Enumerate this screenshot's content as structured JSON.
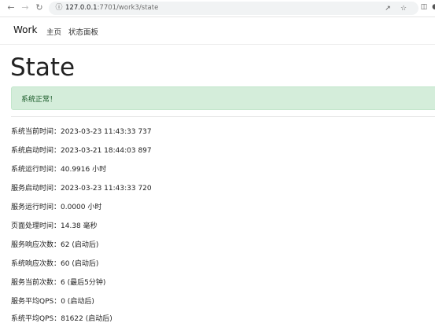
{
  "browser": {
    "url_host": "127.0.0.1",
    "url_path": ":7701/work3/state",
    "icons": {
      "back": "back-arrow-icon",
      "forward": "forward-arrow-icon",
      "reload": "reload-icon",
      "site_info": "site-info-icon",
      "share": "share-icon",
      "bookmark": "star-icon",
      "sidebar": "sidebar-icon",
      "profile": "profile-icon"
    }
  },
  "navbar": {
    "brand": "Work",
    "links": [
      "主页",
      "状态面板"
    ]
  },
  "page": {
    "title": "State",
    "alert": "系统正常！",
    "alert_color": "#d4edda"
  },
  "stats": [
    "系统当前时间：2023-03-23 11:43:33 737",
    "系统启动时间：2023-03-21 18:44:03 897",
    "系统运行时间：40.9916 小时",
    "服务启动时间：2023-03-23 11:43:33 720",
    "服务运行时间：0.0000 小时",
    "页面处理时间：14.38 毫秒",
    "服务响应次数：62 (启动后)",
    "系统响应次数：60 (启动后)",
    "服务当前次数：6 (最后5分钟)",
    "服务平均QPS：0 (启动后)",
    "系统平均QPS：81622 (启动后)"
  ]
}
